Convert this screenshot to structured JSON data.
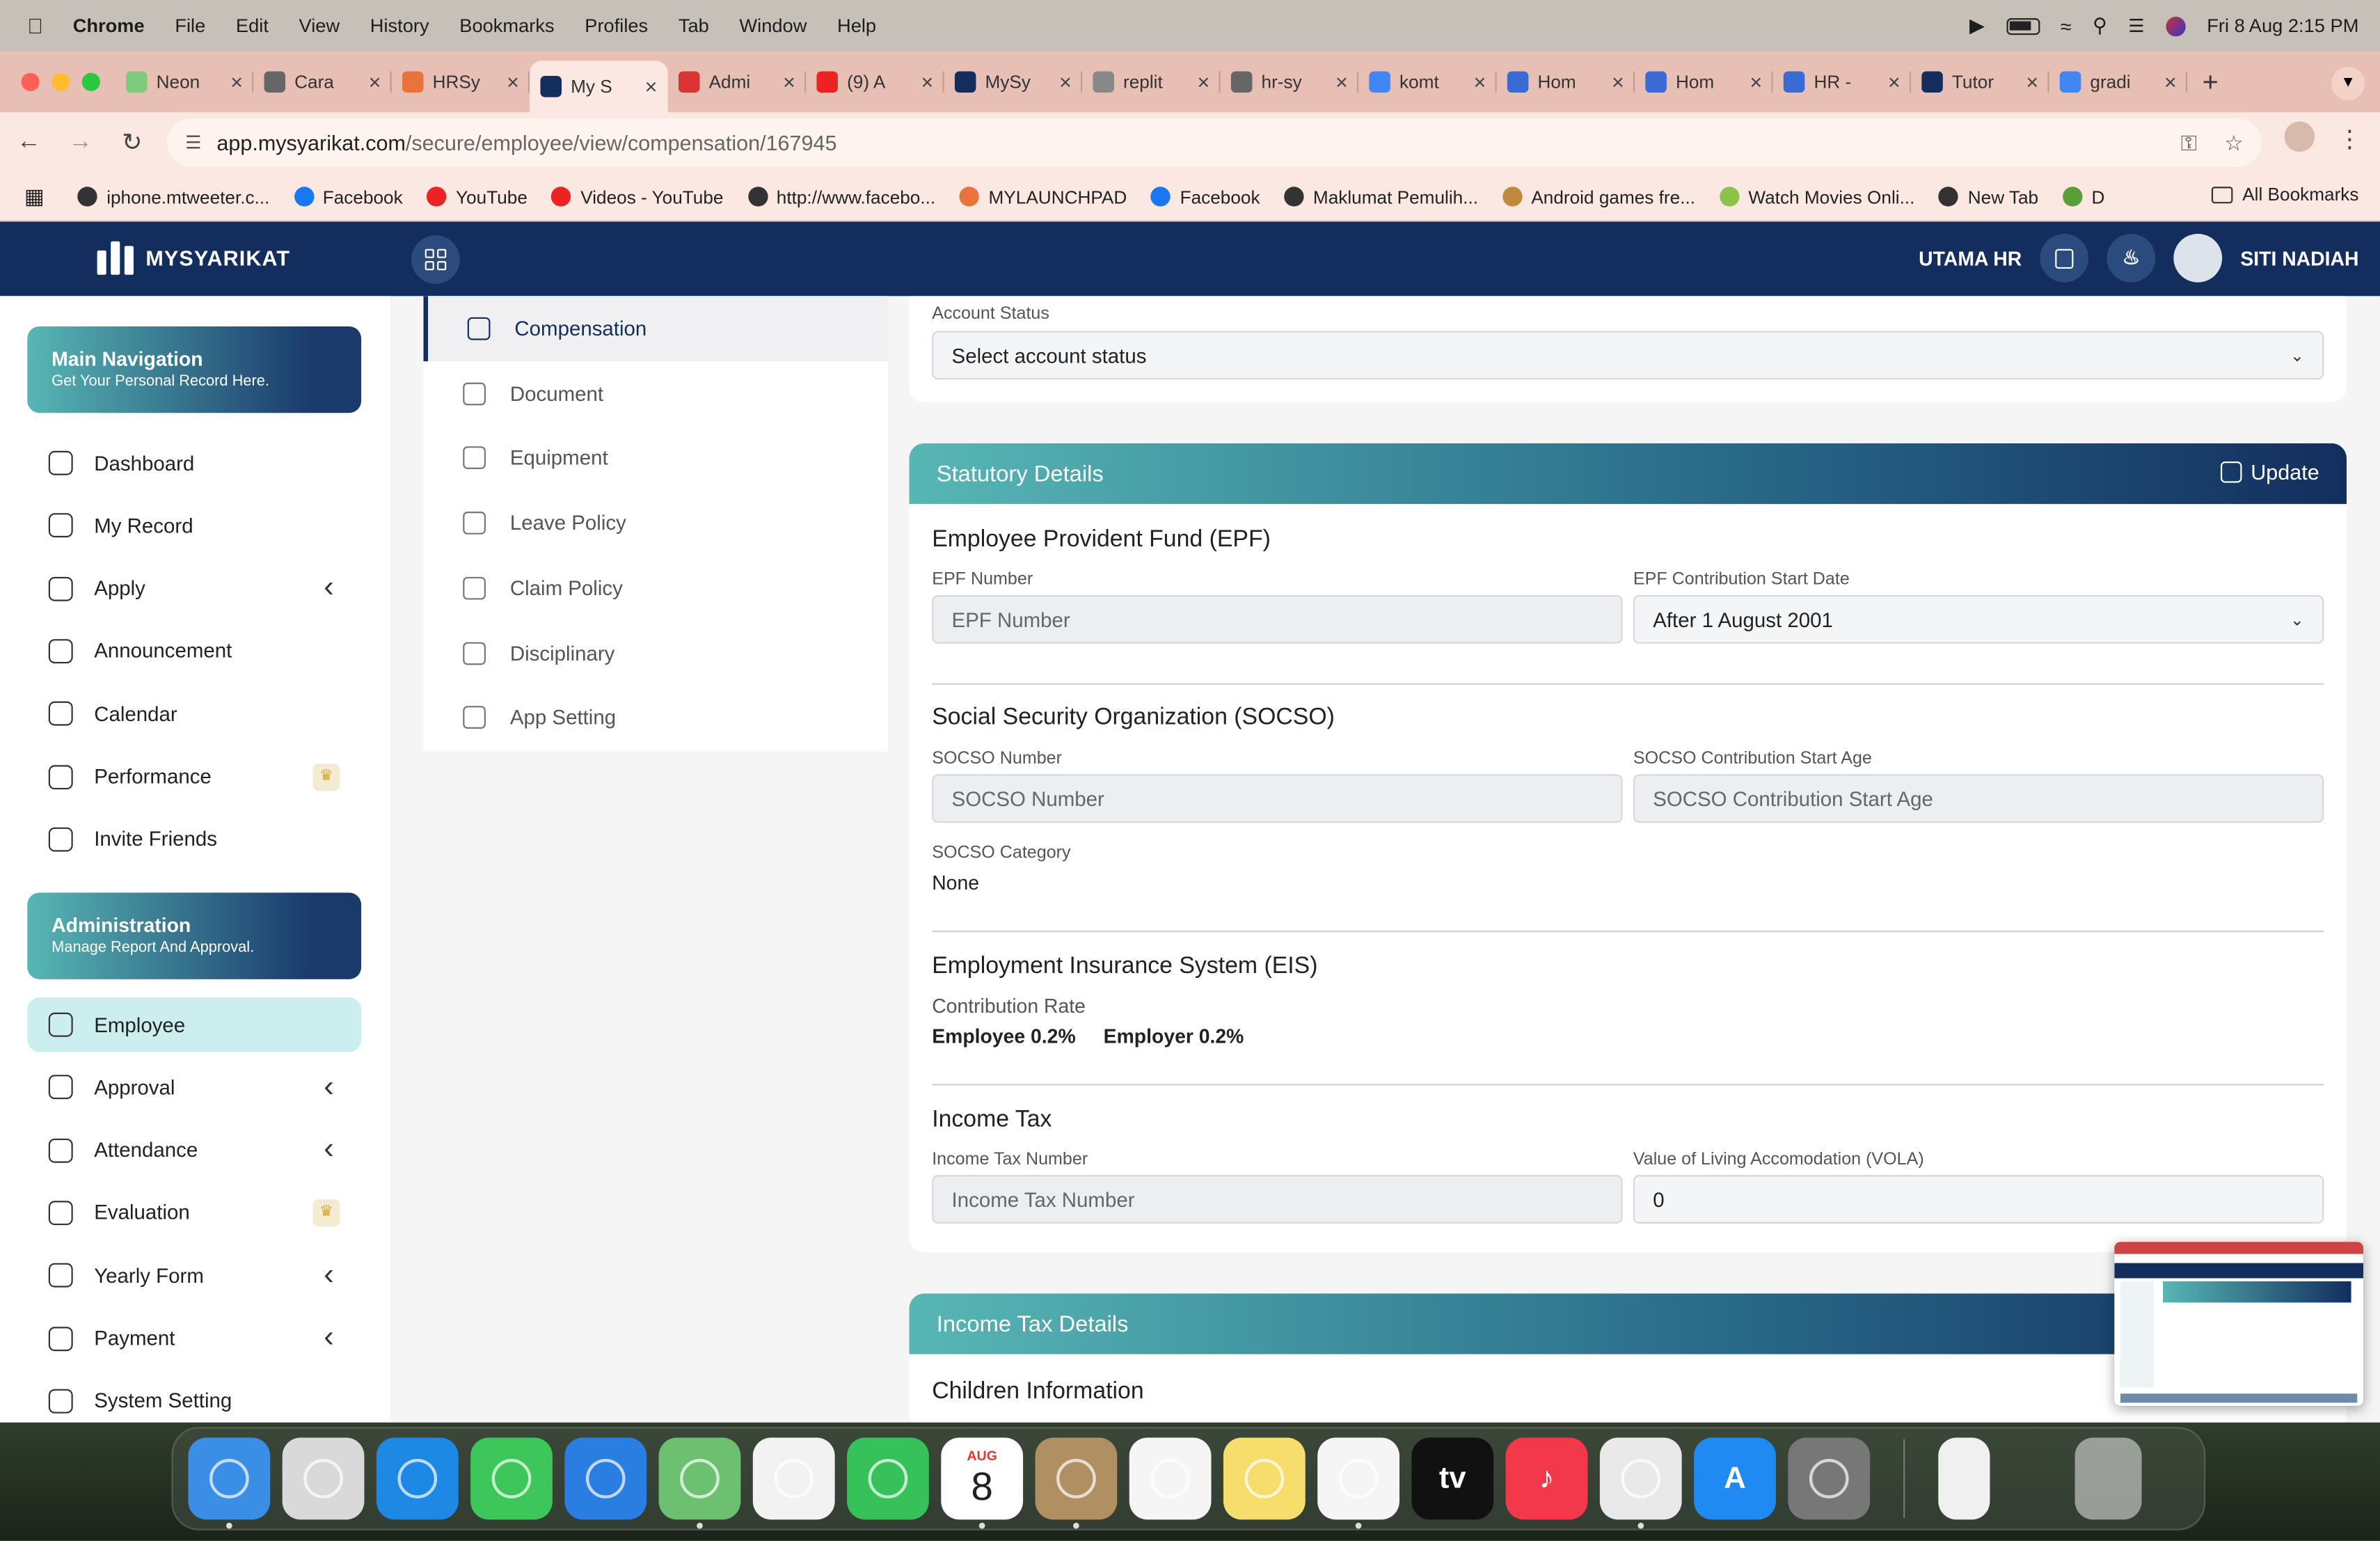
{
  "menubar": {
    "app": "Chrome",
    "items": [
      "File",
      "Edit",
      "View",
      "History",
      "Bookmarks",
      "Profiles",
      "Tab",
      "Window",
      "Help"
    ],
    "datetime": "Fri 8 Aug  2:15 PM"
  },
  "tabs": [
    {
      "title": "Neon",
      "color": "#7ecb7e"
    },
    {
      "title": "Cara",
      "color": "#666"
    },
    {
      "title": "HRSy",
      "color": "#e8743b"
    },
    {
      "title": "My S",
      "color": "#132e5e",
      "active": true
    },
    {
      "title": "Admi",
      "color": "#d33"
    },
    {
      "title": "(9) A",
      "color": "#e22"
    },
    {
      "title": "MySy",
      "color": "#132e5e"
    },
    {
      "title": "replit",
      "color": "#888"
    },
    {
      "title": "hr-sy",
      "color": "#666"
    },
    {
      "title": "komt",
      "color": "#4285f4"
    },
    {
      "title": "Hom",
      "color": "#3a6ad4"
    },
    {
      "title": "Hom",
      "color": "#3a6ad4"
    },
    {
      "title": "HR -",
      "color": "#3a6ad4"
    },
    {
      "title": "Tutor",
      "color": "#132e5e"
    },
    {
      "title": "gradi",
      "color": "#4285f4"
    }
  ],
  "url": {
    "host": "app.mysyarikat.com",
    "path": "/secure/employee/view/compensation/167945"
  },
  "bookmarks": [
    {
      "label": "iphone.mtweeter.c...",
      "color": "#333"
    },
    {
      "label": "Facebook",
      "color": "#1877f2"
    },
    {
      "label": "YouTube",
      "color": "#e22"
    },
    {
      "label": "Videos - YouTube",
      "color": "#e22"
    },
    {
      "label": "http://www.facebo...",
      "color": "#333"
    },
    {
      "label": "MYLAUNCHPAD",
      "color": "#e8743b"
    },
    {
      "label": "Facebook",
      "color": "#1877f2"
    },
    {
      "label": "Maklumat Pemulih...",
      "color": "#333"
    },
    {
      "label": "Android games fre...",
      "color": "#c08a3e"
    },
    {
      "label": "Watch Movies Onli...",
      "color": "#8bc34a"
    },
    {
      "label": "New Tab",
      "color": "#333"
    },
    {
      "label": "D",
      "color": "#5a9e3a"
    }
  ],
  "all_bookmarks": "All Bookmarks",
  "app": {
    "brand": "MYSYARIKAT",
    "company": "UTAMA HR",
    "user": "SITI NADIAH"
  },
  "sidebar": {
    "main_banner": {
      "title": "Main Navigation",
      "subtitle": "Get Your Personal Record Here."
    },
    "main_items": [
      {
        "label": "Dashboard",
        "chevron": false,
        "crown": false
      },
      {
        "label": "My Record",
        "chevron": false,
        "crown": false
      },
      {
        "label": "Apply",
        "chevron": true,
        "crown": false
      },
      {
        "label": "Announcement",
        "chevron": false,
        "crown": false
      },
      {
        "label": "Calendar",
        "chevron": false,
        "crown": false
      },
      {
        "label": "Performance",
        "chevron": false,
        "crown": true
      },
      {
        "label": "Invite Friends",
        "chevron": false,
        "crown": false
      }
    ],
    "admin_banner": {
      "title": "Administration",
      "subtitle": "Manage Report And Approval."
    },
    "admin_items": [
      {
        "label": "Employee",
        "chevron": false,
        "crown": false,
        "active": true
      },
      {
        "label": "Approval",
        "chevron": true,
        "crown": false
      },
      {
        "label": "Attendance",
        "chevron": true,
        "crown": false
      },
      {
        "label": "Evaluation",
        "chevron": false,
        "crown": true
      },
      {
        "label": "Yearly Form",
        "chevron": true,
        "crown": false
      },
      {
        "label": "Payment",
        "chevron": true,
        "crown": false
      },
      {
        "label": "System Setting",
        "chevron": false,
        "crown": false
      }
    ]
  },
  "submenu": [
    {
      "label": "Compensation",
      "active": true
    },
    {
      "label": "Document"
    },
    {
      "label": "Equipment"
    },
    {
      "label": "Leave Policy"
    },
    {
      "label": "Claim Policy"
    },
    {
      "label": "Disciplinary"
    },
    {
      "label": "App Setting"
    }
  ],
  "account": {
    "label": "Account Status",
    "value": "Select account status"
  },
  "statutory": {
    "title": "Statutory Details",
    "update": "Update",
    "epf": {
      "title": "Employee Provident Fund (EPF)",
      "number_label": "EPF Number",
      "number_placeholder": "EPF Number",
      "start_label": "EPF Contribution Start Date",
      "start_value": "After 1 August 2001"
    },
    "socso": {
      "title": "Social Security Organization (SOCSO)",
      "number_label": "SOCSO Number",
      "number_placeholder": "SOCSO Number",
      "age_label": "SOCSO Contribution Start Age",
      "age_placeholder": "SOCSO Contribution Start Age",
      "category_label": "SOCSO Category",
      "category_value": "None"
    },
    "eis": {
      "title": "Employment Insurance System (EIS)",
      "rate_label": "Contribution Rate",
      "employee": "Employee 0.2%",
      "employer": "Employer 0.2%"
    },
    "tax": {
      "title": "Income Tax",
      "number_label": "Income Tax Number",
      "number_placeholder": "Income Tax Number",
      "vola_label": "Value of Living Accomodation (VOLA)",
      "vola_value": "0"
    }
  },
  "income_tax_details": {
    "title": "Income Tax Details",
    "children": "Children Information"
  },
  "dock": [
    {
      "name": "finder",
      "color": "#3a8ee6",
      "text": ""
    },
    {
      "name": "launchpad",
      "color": "#d9d9d9",
      "text": ""
    },
    {
      "name": "safari",
      "color": "#1e88e5",
      "text": ""
    },
    {
      "name": "messages",
      "color": "#3dc75a",
      "text": ""
    },
    {
      "name": "mail",
      "color": "#2a7de1",
      "text": ""
    },
    {
      "name": "maps",
      "color": "#6cc070",
      "text": ""
    },
    {
      "name": "photos",
      "color": "#f2f2f2",
      "text": ""
    },
    {
      "name": "facetime",
      "color": "#36c15b",
      "text": ""
    },
    {
      "name": "calendar",
      "color": "#ffffff",
      "text": "8",
      "sub": "AUG"
    },
    {
      "name": "contacts",
      "color": "#b08f62",
      "text": ""
    },
    {
      "name": "reminders",
      "color": "#f5f5f5",
      "text": ""
    },
    {
      "name": "notes",
      "color": "#f7dd6b",
      "text": ""
    },
    {
      "name": "freeform",
      "color": "#f5f5f5",
      "text": ""
    },
    {
      "name": "apple-tv",
      "color": "#111",
      "text": "tv"
    },
    {
      "name": "music",
      "color": "#f3384c",
      "text": "♪"
    },
    {
      "name": "chrome",
      "color": "#e9e9e9",
      "text": ""
    },
    {
      "name": "app-store",
      "color": "#1f8bf2",
      "text": "A"
    },
    {
      "name": "system-settings",
      "color": "#777",
      "text": ""
    }
  ]
}
